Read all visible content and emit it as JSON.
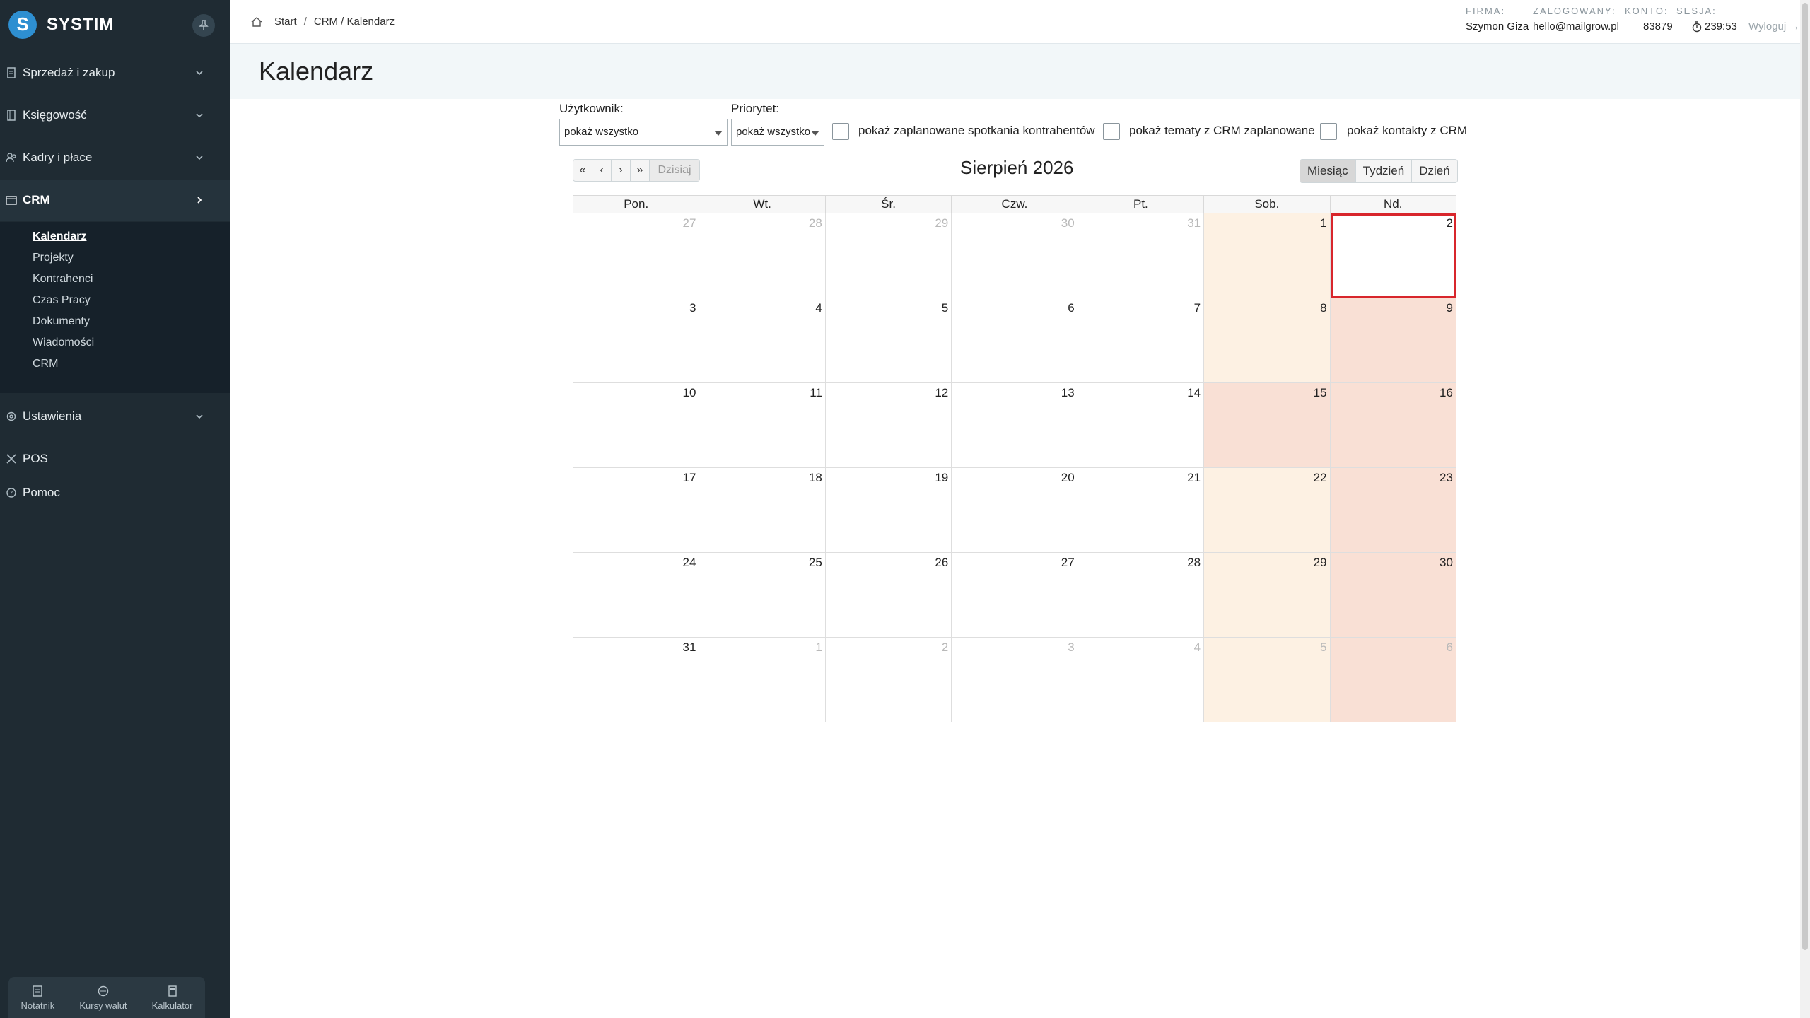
{
  "brand": {
    "name": "SYSTIM",
    "logo_letter": "S",
    "accent": "#2e8fd1"
  },
  "sidebar": {
    "items": [
      {
        "label": "Sprzedaż i zakup",
        "icon": "receipt-icon"
      },
      {
        "label": "Księgowość",
        "icon": "book-icon"
      },
      {
        "label": "Kadry i płace",
        "icon": "users-icon"
      },
      {
        "label": "CRM",
        "icon": "calendar-icon"
      },
      {
        "label": "Ustawienia",
        "icon": "gear-icon"
      },
      {
        "label": "POS",
        "icon": "tools-icon"
      },
      {
        "label": "Pomoc",
        "icon": "help-icon"
      }
    ],
    "crm_submenu": [
      "Kalendarz",
      "Projekty",
      "Kontrahenci",
      "Czas Pracy",
      "Dokumenty",
      "Wiadomości",
      "CRM"
    ],
    "bottom_tools": [
      {
        "label": "Notatnik",
        "icon": "note-icon"
      },
      {
        "label": "Kursy walut",
        "icon": "currency-icon"
      },
      {
        "label": "Kalkulator",
        "icon": "calculator-icon"
      }
    ]
  },
  "breadcrumb": {
    "home": "Start",
    "path": "CRM / Kalendarz"
  },
  "userinfo": {
    "firma_label": "FIRMA:",
    "zalogowany_label": "ZALOGOWANY:",
    "konto_label": "KONTO:",
    "sesja_label": "SESJA:",
    "user": "Szymon Giza",
    "email": "hello@mailgrow.pl",
    "konto": "83879",
    "sesja": "239:53",
    "logout": "Wyloguj →"
  },
  "page": {
    "title": "Kalendarz"
  },
  "filters": {
    "user_label": "Użytkownik:",
    "user_value": "pokaż wszystko",
    "priority_label": "Priorytet:",
    "priority_value": "pokaż wszystko",
    "cb1": "pokaż zaplanowane spotkania kontrahentów",
    "cb2": "pokaż tematy z CRM zaplanowane",
    "cb3": "pokaż kontakty z CRM"
  },
  "calendar": {
    "title": "Sierpień 2026",
    "nav": [
      "«",
      "‹",
      "›",
      "»"
    ],
    "today": "Dzisiaj",
    "views": [
      "Miesiąc",
      "Tydzień",
      "Dzień"
    ],
    "active_view": "Miesiąc",
    "weekdays": [
      "Pon.",
      "Wt.",
      "Śr.",
      "Czw.",
      "Pt.",
      "Sob.",
      "Nd."
    ],
    "today_date": "2",
    "holidays": [
      "15"
    ],
    "weeks": [
      [
        [
          "27",
          1
        ],
        [
          "28",
          1
        ],
        [
          "29",
          1
        ],
        [
          "30",
          1
        ],
        [
          "31",
          1
        ],
        [
          "1",
          0
        ],
        [
          "2",
          0
        ]
      ],
      [
        [
          "3",
          0
        ],
        [
          "4",
          0
        ],
        [
          "5",
          0
        ],
        [
          "6",
          0
        ],
        [
          "7",
          0
        ],
        [
          "8",
          0
        ],
        [
          "9",
          0
        ]
      ],
      [
        [
          "10",
          0
        ],
        [
          "11",
          0
        ],
        [
          "12",
          0
        ],
        [
          "13",
          0
        ],
        [
          "14",
          0
        ],
        [
          "15",
          0
        ],
        [
          "16",
          0
        ]
      ],
      [
        [
          "17",
          0
        ],
        [
          "18",
          0
        ],
        [
          "19",
          0
        ],
        [
          "20",
          0
        ],
        [
          "21",
          0
        ],
        [
          "22",
          0
        ],
        [
          "23",
          0
        ]
      ],
      [
        [
          "24",
          0
        ],
        [
          "25",
          0
        ],
        [
          "26",
          0
        ],
        [
          "27",
          0
        ],
        [
          "28",
          0
        ],
        [
          "29",
          0
        ],
        [
          "30",
          0
        ]
      ],
      [
        [
          "31",
          0
        ],
        [
          "1",
          1
        ],
        [
          "2",
          1
        ],
        [
          "3",
          1
        ],
        [
          "4",
          1
        ],
        [
          "5",
          1
        ],
        [
          "6",
          1
        ]
      ]
    ]
  }
}
